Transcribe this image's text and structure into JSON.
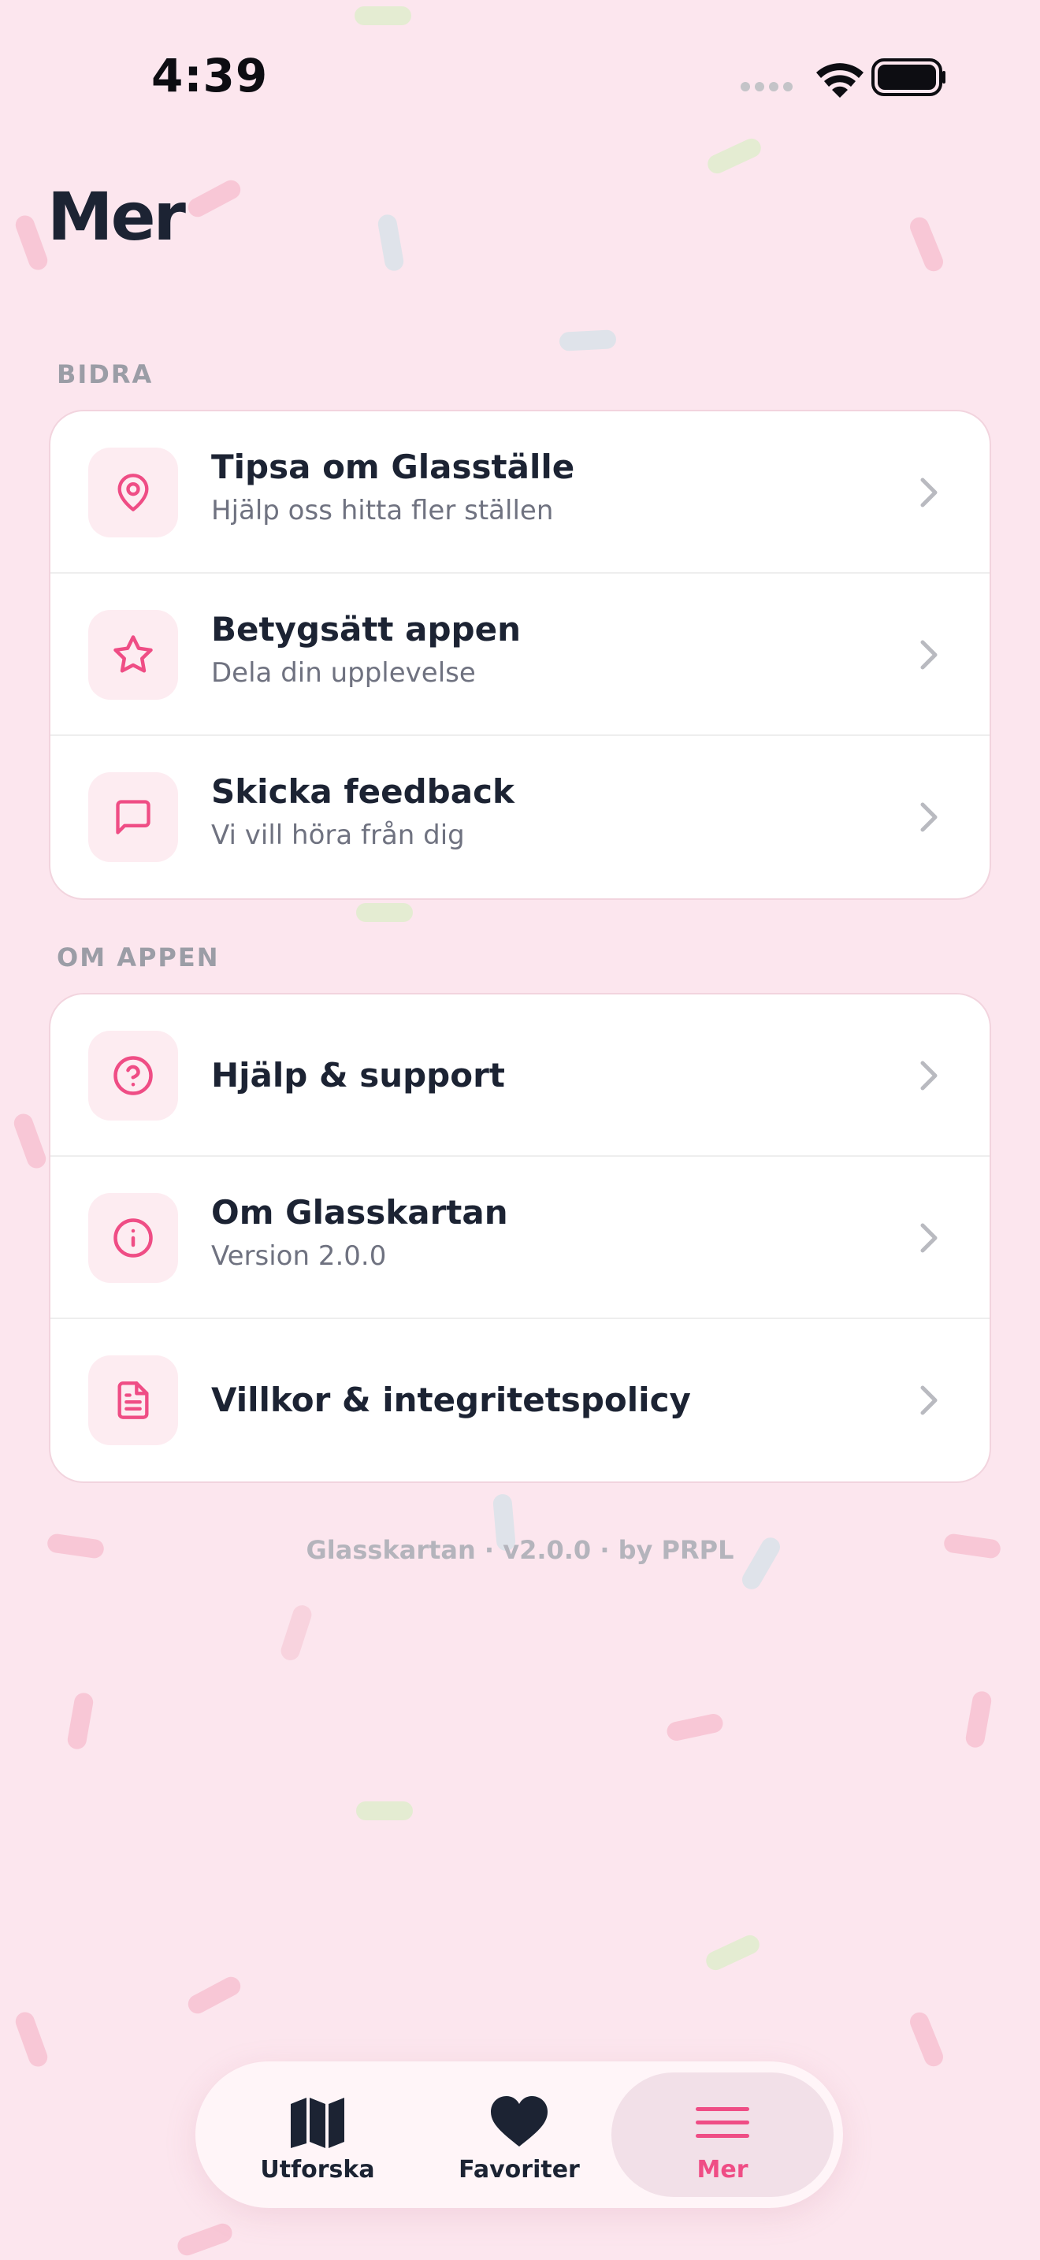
{
  "status_bar": {
    "time": "4:39"
  },
  "header": {
    "title": "Mer"
  },
  "sections": [
    {
      "title": "BIDRA",
      "items": [
        {
          "title": "Tipsa om Glasställe",
          "subtitle": "Hjälp oss hitta fler ställen",
          "icon": "map-pin-icon"
        },
        {
          "title": "Betygsätt appen",
          "subtitle": "Dela din upplevelse",
          "icon": "star-icon"
        },
        {
          "title": "Skicka feedback",
          "subtitle": "Vi vill höra från dig",
          "icon": "message-icon"
        }
      ]
    },
    {
      "title": "OM APPEN",
      "items": [
        {
          "title": "Hjälp & support",
          "subtitle": "",
          "icon": "question-circle-icon"
        },
        {
          "title": "Om Glasskartan",
          "subtitle": "Version 2.0.0",
          "icon": "info-circle-icon"
        },
        {
          "title": "Villkor & integritetspolicy",
          "subtitle": "",
          "icon": "document-icon"
        }
      ]
    }
  ],
  "footer": {
    "text": "Glasskartan · v2.0.0 · by PRPL"
  },
  "tabbar": {
    "tabs": [
      {
        "label": "Utforska",
        "icon": "map-icon",
        "active": false
      },
      {
        "label": "Favoriter",
        "icon": "heart-icon",
        "active": false
      },
      {
        "label": "Mer",
        "icon": "menu-icon",
        "active": true
      }
    ]
  },
  "colors": {
    "accent": "#ef4d85",
    "background": "#fce6ee",
    "icon_bg": "#fdecf1"
  }
}
